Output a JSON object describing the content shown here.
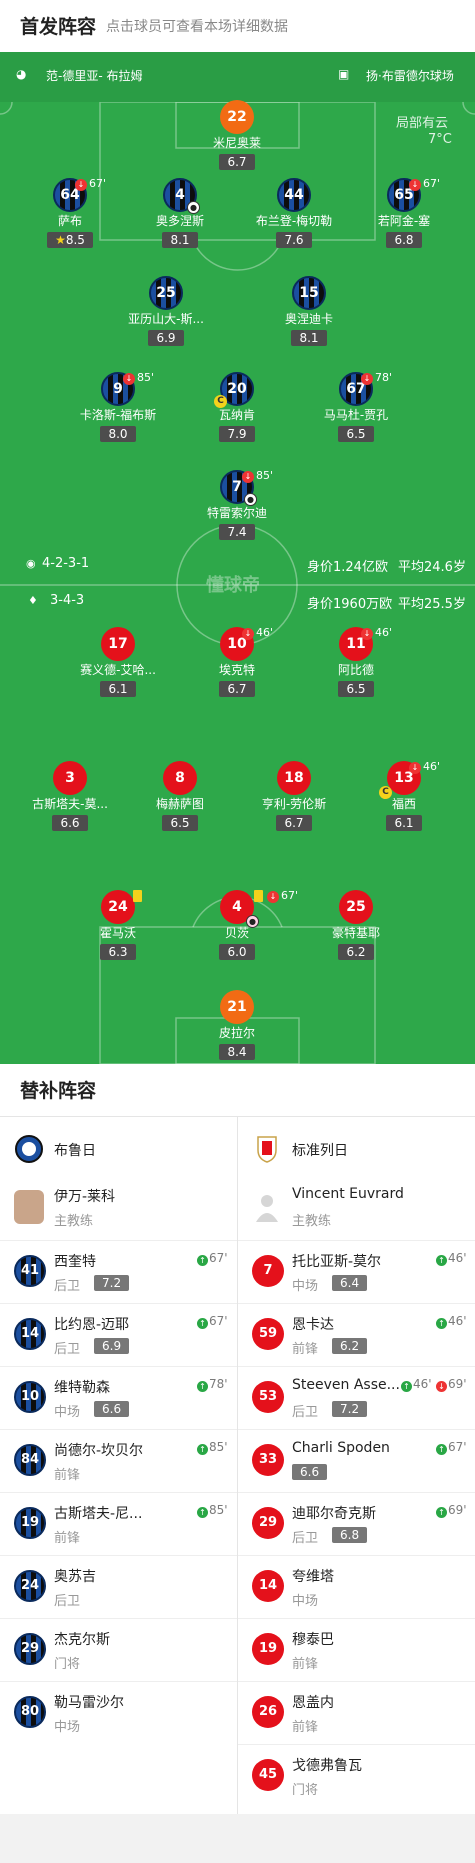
{
  "header": {
    "title": "首发阵容",
    "subtitle": "点击球员可查看本场详细数据"
  },
  "match": {
    "referee": "范-德里亚- 布拉姆",
    "stadium": "扬·布雷德尔球场",
    "weather": "局部有云",
    "temp": "7°C",
    "watermark": "懂球帝"
  },
  "home": {
    "formation": "4-2-3-1",
    "value": "身价1.24亿欧",
    "age": "平均24.6岁"
  },
  "away": {
    "formation": "3-4-3",
    "value": "身价1960万欧",
    "age": "平均25.5岁"
  },
  "home_players": {
    "gk": {
      "num": "22",
      "name": "米尼奥莱",
      "rating": "6.7"
    },
    "sab": {
      "num": "64",
      "name": "萨布",
      "rating": "8.5",
      "min": "67'"
    },
    "ordo": {
      "num": "4",
      "name": "奥多涅斯",
      "rating": "8.1"
    },
    "mech": {
      "num": "44",
      "name": "布兰登-梅切勒",
      "rating": "7.6"
    },
    "seys": {
      "num": "65",
      "name": "若阿金-塞",
      "rating": "6.8",
      "min": "67'"
    },
    "alex": {
      "num": "25",
      "name": "亚历山大-斯...",
      "rating": "6.9"
    },
    "onye": {
      "num": "15",
      "name": "奥涅迪卡",
      "rating": "8.1"
    },
    "forbs": {
      "num": "9",
      "name": "卡洛斯-福布斯",
      "rating": "8.0",
      "min": "85'"
    },
    "vana": {
      "num": "20",
      "name": "瓦纳肯",
      "rating": "7.9"
    },
    "jash": {
      "num": "67",
      "name": "马马杜-贾孔",
      "rating": "6.5",
      "min": "78'"
    },
    "tzol": {
      "num": "7",
      "name": "特雷索尔迪",
      "rating": "7.4",
      "min": "85'"
    }
  },
  "away_players": {
    "sai": {
      "num": "17",
      "name": "赛义德-艾哈...",
      "rating": "6.1"
    },
    "eck": {
      "num": "10",
      "name": "埃克特",
      "rating": "6.7",
      "min": "46'"
    },
    "abid": {
      "num": "11",
      "name": "阿比德",
      "rating": "6.5",
      "min": "46'"
    },
    "gust": {
      "num": "3",
      "name": "古斯塔夫-莫...",
      "rating": "6.6"
    },
    "meh": {
      "num": "8",
      "name": "梅赫萨图",
      "rating": "6.5"
    },
    "lawr": {
      "num": "18",
      "name": "亨利-劳伦斯",
      "rating": "6.7"
    },
    "fos": {
      "num": "13",
      "name": "福西",
      "rating": "6.1",
      "min": "46'"
    },
    "hom": {
      "num": "24",
      "name": "霍马沃",
      "rating": "6.3"
    },
    "bei": {
      "num": "4",
      "name": "贝茨",
      "rating": "6.0",
      "min": "67'"
    },
    "haot": {
      "num": "25",
      "name": "豪特基耶",
      "rating": "6.2"
    },
    "gk": {
      "num": "21",
      "name": "皮拉尔",
      "rating": "8.4"
    }
  },
  "bench": {
    "title": "替补阵容",
    "home_team": "布鲁日",
    "away_team": "标准列日",
    "home_coach": {
      "name": "伊万-莱科",
      "role": "主教练"
    },
    "away_coach": {
      "name": "Vincent Euvrard",
      "role": "主教练"
    },
    "home_subs": [
      {
        "num": "41",
        "name": "西奎特",
        "pos": "后卫",
        "rating": "7.2",
        "in": "67'"
      },
      {
        "num": "14",
        "name": "比约恩-迈耶",
        "pos": "后卫",
        "rating": "6.9",
        "in": "67'"
      },
      {
        "num": "10",
        "name": "维特勒森",
        "pos": "中场",
        "rating": "6.6",
        "in": "78'"
      },
      {
        "num": "84",
        "name": "尚德尔-坎贝尔",
        "pos": "前锋",
        "rating": "",
        "in": "85'"
      },
      {
        "num": "19",
        "name": "古斯塔夫-尼...",
        "pos": "前锋",
        "rating": "",
        "in": "85'"
      },
      {
        "num": "24",
        "name": "奥苏吉",
        "pos": "后卫",
        "rating": "",
        "in": ""
      },
      {
        "num": "29",
        "name": "杰克尔斯",
        "pos": "门将",
        "rating": "",
        "in": ""
      },
      {
        "num": "80",
        "name": "勒马雷沙尔",
        "pos": "中场",
        "rating": "",
        "in": ""
      }
    ],
    "away_subs": [
      {
        "num": "7",
        "name": "托比亚斯-莫尔",
        "pos": "中场",
        "rating": "6.4",
        "in": "46'",
        "out": ""
      },
      {
        "num": "59",
        "name": "恩卡达",
        "pos": "前锋",
        "rating": "6.2",
        "in": "46'",
        "out": ""
      },
      {
        "num": "53",
        "name": "Steeven Asse...",
        "pos": "后卫",
        "rating": "7.2",
        "in": "46'",
        "out": "69'"
      },
      {
        "num": "33",
        "name": "Charli Spoden",
        "pos": "",
        "rating": "6.6",
        "in": "67'",
        "out": ""
      },
      {
        "num": "29",
        "name": "迪耶尔奇克斯",
        "pos": "后卫",
        "rating": "6.8",
        "in": "69'",
        "out": ""
      },
      {
        "num": "14",
        "name": "夸维塔",
        "pos": "中场",
        "rating": "",
        "in": "",
        "out": ""
      },
      {
        "num": "19",
        "name": "穆泰巴",
        "pos": "前锋",
        "rating": "",
        "in": "",
        "out": ""
      },
      {
        "num": "26",
        "name": "恩盖内",
        "pos": "前锋",
        "rating": "",
        "in": "",
        "out": ""
      },
      {
        "num": "45",
        "name": "戈德弗鲁瓦",
        "pos": "门将",
        "rating": "",
        "in": "",
        "out": ""
      }
    ]
  },
  "colors": {
    "pitch": "#2ea84a",
    "home_kit": "#1b4fa0",
    "away_kit": "#e4111b",
    "gk": "#f26b14",
    "sub_in": "#29a745",
    "sub_out": "#e33"
  }
}
